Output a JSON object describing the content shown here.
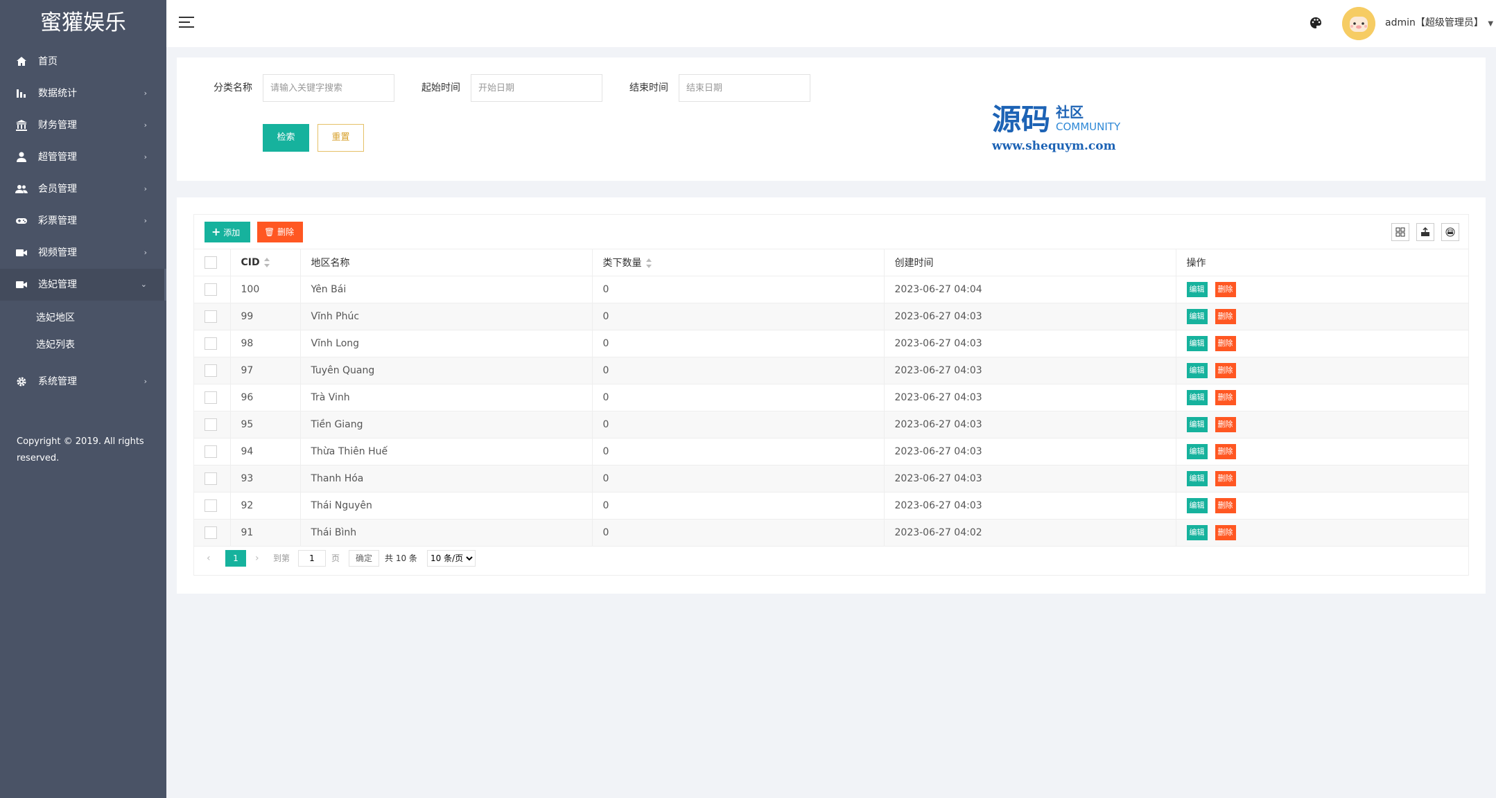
{
  "app": {
    "brand": "蜜獾娱乐"
  },
  "sidebar": {
    "items": [
      {
        "label": "首页",
        "icon": "home-icon",
        "has_children": false
      },
      {
        "label": "数据统计",
        "icon": "bar-chart-icon",
        "has_children": true
      },
      {
        "label": "财务管理",
        "icon": "bank-icon",
        "has_children": true
      },
      {
        "label": "超管管理",
        "icon": "user-icon",
        "has_children": true
      },
      {
        "label": "会员管理",
        "icon": "users-icon",
        "has_children": true
      },
      {
        "label": "彩票管理",
        "icon": "gamepad-icon",
        "has_children": true
      },
      {
        "label": "视频管理",
        "icon": "video-icon",
        "has_children": true
      },
      {
        "label": "选妃管理",
        "icon": "video-icon",
        "has_children": true,
        "open": true
      },
      {
        "label": "系统管理",
        "icon": "gear-icon",
        "has_children": true
      }
    ],
    "submenu": [
      {
        "label": "选妃地区"
      },
      {
        "label": "选妃列表"
      }
    ],
    "copyright": "Copyright © 2019. All rights reserved."
  },
  "header": {
    "user_label": "admin【超级管理员】"
  },
  "search": {
    "category_label": "分类名称",
    "category_placeholder": "请输入关键字搜索",
    "start_label": "起始时间",
    "start_placeholder": "开始日期",
    "end_label": "结束时间",
    "end_placeholder": "结束日期",
    "search_button": "检索",
    "reset_button": "重置"
  },
  "watermark": {
    "big": "源码",
    "small": "社区",
    "community": "COMMUNITY",
    "url": "www.shequym.com"
  },
  "toolbar": {
    "add_label": "添加",
    "delete_label": "删除"
  },
  "table": {
    "columns": [
      "CID",
      "地区名称",
      "类下数量",
      "创建时间",
      "操作"
    ],
    "rows": [
      {
        "cid": "100",
        "name": "Yên Bái",
        "count": "0",
        "created": "2023-06-27 04:04"
      },
      {
        "cid": "99",
        "name": "Vĩnh Phúc",
        "count": "0",
        "created": "2023-06-27 04:03"
      },
      {
        "cid": "98",
        "name": "Vĩnh Long",
        "count": "0",
        "created": "2023-06-27 04:03"
      },
      {
        "cid": "97",
        "name": "Tuyên Quang",
        "count": "0",
        "created": "2023-06-27 04:03"
      },
      {
        "cid": "96",
        "name": "Trà Vinh",
        "count": "0",
        "created": "2023-06-27 04:03"
      },
      {
        "cid": "95",
        "name": "Tiền Giang",
        "count": "0",
        "created": "2023-06-27 04:03"
      },
      {
        "cid": "94",
        "name": "Thừa Thiên Huế",
        "count": "0",
        "created": "2023-06-27 04:03"
      },
      {
        "cid": "93",
        "name": "Thanh Hóa",
        "count": "0",
        "created": "2023-06-27 04:03"
      },
      {
        "cid": "92",
        "name": "Thái Nguyên",
        "count": "0",
        "created": "2023-06-27 04:03"
      },
      {
        "cid": "91",
        "name": "Thái Bình",
        "count": "0",
        "created": "2023-06-27 04:02"
      }
    ],
    "row_actions": {
      "edit": "编辑",
      "delete": "删除"
    }
  },
  "pager": {
    "current": "1",
    "goto_label": "到第",
    "goto_value": "1",
    "page_unit": "页",
    "confirm": "确定",
    "total": "共 10 条",
    "page_size": "10 条/页"
  },
  "colors": {
    "sidebar_bg": "#4a5366",
    "primary": "#16b29d",
    "danger": "#ff5722",
    "warning": "#d7a02c"
  }
}
